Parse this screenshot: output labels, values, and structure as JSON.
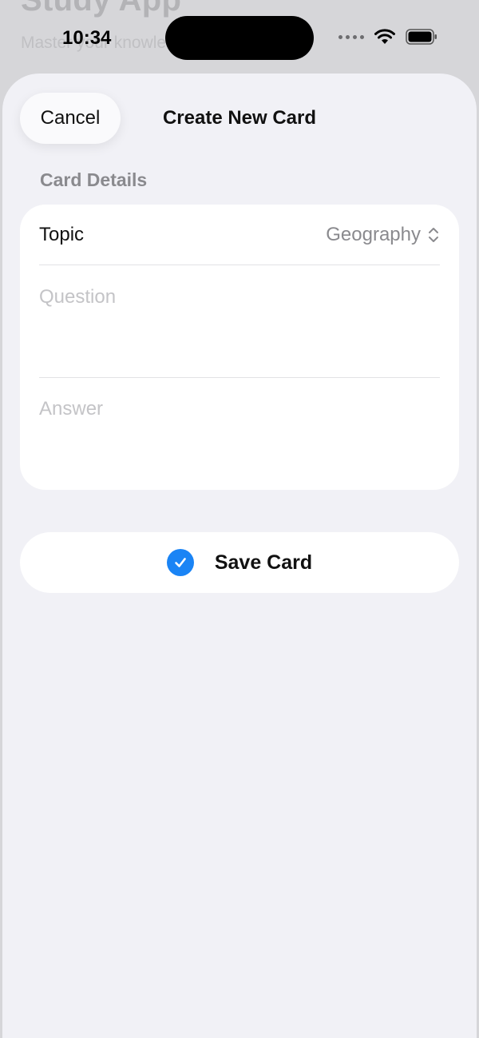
{
  "background_app": {
    "title": "Study App",
    "subtitle": "Master your knowledge with flashcards"
  },
  "status_bar": {
    "time": "10:34"
  },
  "sheet": {
    "cancel_label": "Cancel",
    "title": "Create New Card",
    "section_header": "Card Details",
    "topic": {
      "label": "Topic",
      "value": "Geography"
    },
    "question": {
      "value": "",
      "placeholder": "Question"
    },
    "answer": {
      "value": "",
      "placeholder": "Answer"
    },
    "save_label": "Save Card"
  },
  "icons": {
    "picker": "chevron-up-down-icon",
    "save": "checkmark-circle-icon",
    "wifi": "wifi-icon",
    "battery": "battery-icon"
  },
  "colors": {
    "accent": "#1a84f5",
    "sheet_background": "#f1f1f6",
    "card_background": "#ffffff",
    "secondary_text": "#8a8a8e",
    "placeholder_text": "#c4c4c7"
  }
}
